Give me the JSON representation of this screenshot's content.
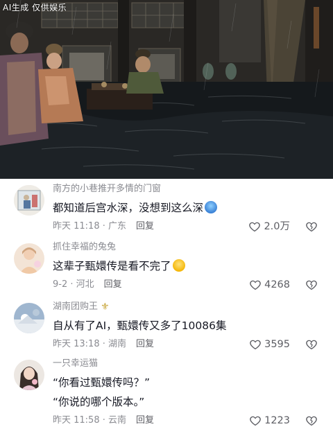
{
  "video": {
    "watermark": "AI生成 仅供娱乐"
  },
  "comments": [
    {
      "username": "南方的小巷推开多情的门窗",
      "text": "都知道后宫水深，没想到这么深",
      "emoji": "scared-face-emoji",
      "time": "昨天 11:18",
      "location": "广东",
      "reply_label": "回复",
      "likes": "2.0万",
      "badge": null
    },
    {
      "username": "抓住幸福的兔兔",
      "text": "这辈子甄嬛传是看不完了",
      "emoji": "laughing-crying-face-emoji",
      "time": "9-2",
      "location": "河北",
      "reply_label": "回复",
      "likes": "4268",
      "badge": null
    },
    {
      "username": "湖南团购王",
      "text": "自从有了AI，甄嬛传又多了10086集",
      "emoji": null,
      "time": "昨天 13:18",
      "location": "湖南",
      "reply_label": "回复",
      "likes": "3595",
      "badge": "fleur-de-lis-badge"
    },
    {
      "username": "一只幸运猫",
      "text": "“你看过甄嬛传吗？”",
      "text2": "“你说的哪个版本。”",
      "emoji": null,
      "time": "昨天 11:58",
      "location": "云南",
      "reply_label": "回复",
      "likes": "1223",
      "badge": null
    }
  ],
  "colors": {
    "secondary_text": "#8a8b91",
    "primary_text": "#161823",
    "action_text": "#5c5d63"
  }
}
